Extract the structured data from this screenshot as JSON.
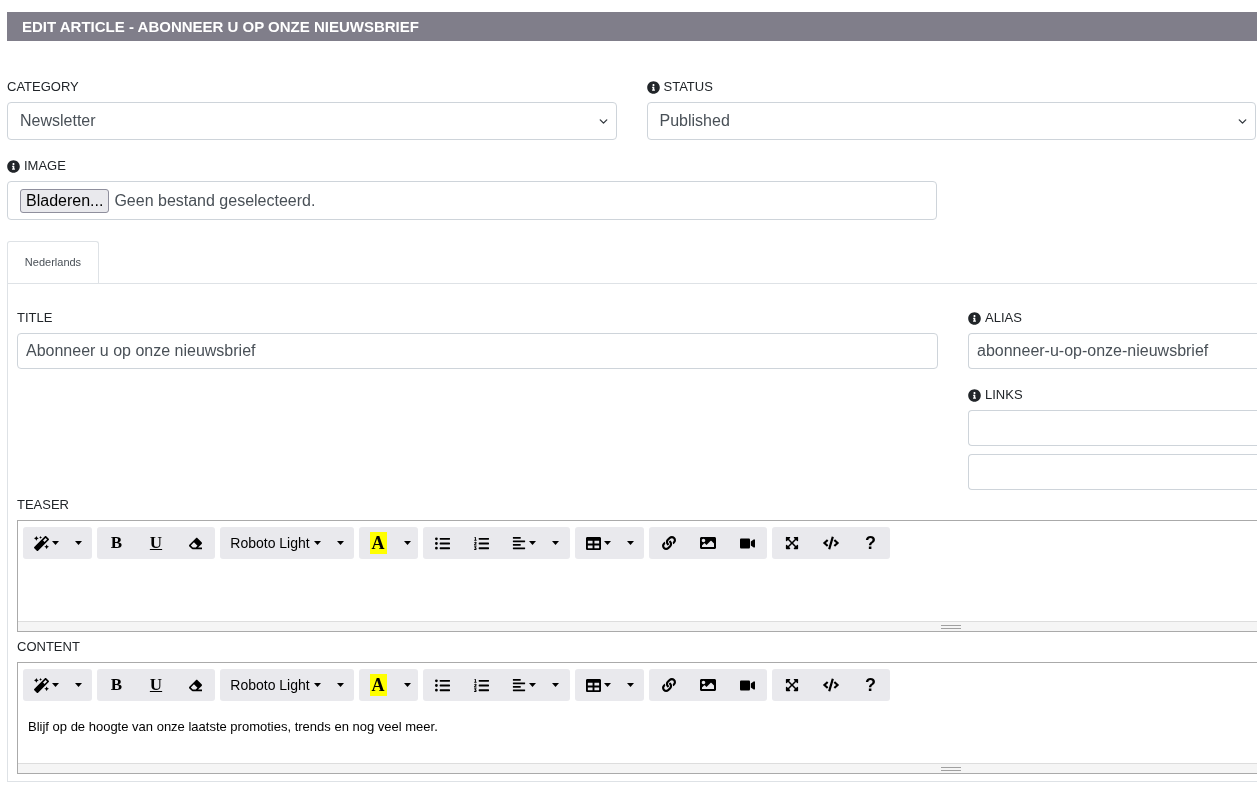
{
  "page_header": {
    "title": "EDIT ARTICLE - ABONNEER U OP ONZE NIEUWSBRIEF"
  },
  "category": {
    "label": "CATEGORY",
    "value": "Newsletter"
  },
  "status": {
    "label": "STATUS",
    "info": true,
    "value": "Published"
  },
  "image": {
    "label": "IMAGE",
    "info": true,
    "button": "Bladeren...",
    "file_name": "Geen bestand geselecteerd."
  },
  "tabs": [
    {
      "label": "Nederlands",
      "selected": true
    }
  ],
  "title": {
    "label": "TITLE",
    "value": "Abonneer u op onze nieuwsbrief"
  },
  "alias": {
    "label": "ALIAS",
    "info": true,
    "value": "abonneer-u-op-onze-nieuwsbrief"
  },
  "links": {
    "label": "LINKS",
    "info": true
  },
  "editors": [
    {
      "label": "TEASER",
      "toolbar": {
        "bold": "B",
        "underline": "U",
        "font": "Roboto Light",
        "text_color": "A",
        "help": "?"
      }
    },
    {
      "label": "CONTENT",
      "toolbar": {
        "bold": "B",
        "underline": "U",
        "font": "Roboto Light",
        "text_color": "A",
        "help": "?"
      },
      "body": "Blijf op de hoogte van onze laatste promoties, trends en nog veel meer."
    }
  ]
}
